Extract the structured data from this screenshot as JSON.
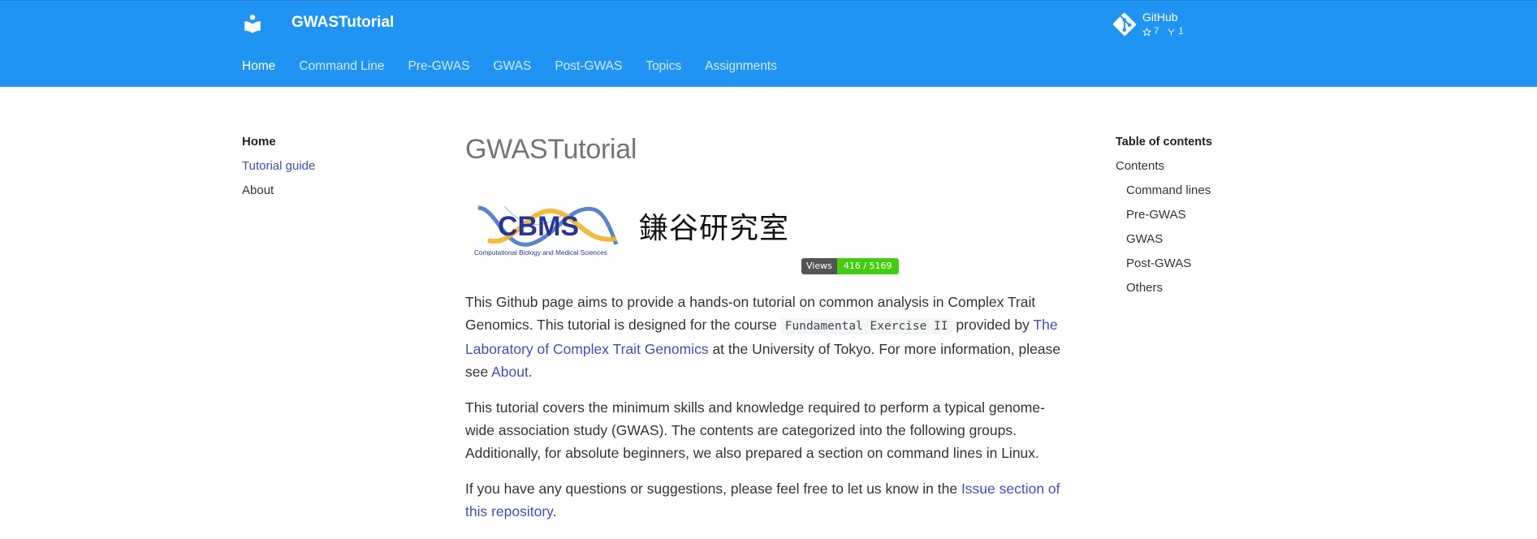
{
  "header": {
    "site_title": "GWASTutorial",
    "tabs": [
      {
        "label": "Home",
        "active": true
      },
      {
        "label": "Command Line"
      },
      {
        "label": "Pre-GWAS"
      },
      {
        "label": "GWAS"
      },
      {
        "label": "Post-GWAS"
      },
      {
        "label": "Topics"
      },
      {
        "label": "Assignments"
      }
    ],
    "repo": {
      "name": "GitHub",
      "stars": "7",
      "forks": "1"
    },
    "color": "#2094f3"
  },
  "left_nav": {
    "title": "Home",
    "items": [
      {
        "label": "Tutorial guide",
        "current": true
      },
      {
        "label": "About"
      }
    ]
  },
  "main": {
    "title": "GWASTutorial",
    "banner": {
      "logo_text": "CBMS",
      "logo_subtitle": "Computational Biology and Medical Sciences",
      "lab_name": "鎌谷研究室",
      "badge_label": "Views",
      "badge_value": "416 / 5169"
    },
    "p1": {
      "t1": "This Github page aims to provide a hands-on tutorial on common analysis in Complex Trait Genomics. This tutorial is designed for the course ",
      "code": "Fundamental Exercise II",
      "t2": " provided by ",
      "link1": "The Laboratory of Complex Trait Genomics",
      "t3": " at the University of Tokyo. For more information, please see ",
      "link2": "About",
      "t4": "."
    },
    "p2": "This tutorial covers the minimum skills and knowledge required to perform a typical genome-wide association study (GWAS). The contents are categorized into the following groups. Additionally, for absolute beginners, we also prepared a section on command lines in Linux.",
    "p3": {
      "t1": "If you have any questions or suggestions, please feel free to let us know in the ",
      "link": "Issue section of this repository",
      "t2": "."
    }
  },
  "toc": {
    "title": "Table of contents",
    "items": [
      {
        "label": "Contents"
      },
      {
        "label": "Command lines",
        "sub": true
      },
      {
        "label": "Pre-GWAS",
        "sub": true
      },
      {
        "label": "GWAS",
        "sub": true
      },
      {
        "label": "Post-GWAS",
        "sub": true
      },
      {
        "label": "Others",
        "sub": true
      }
    ]
  }
}
